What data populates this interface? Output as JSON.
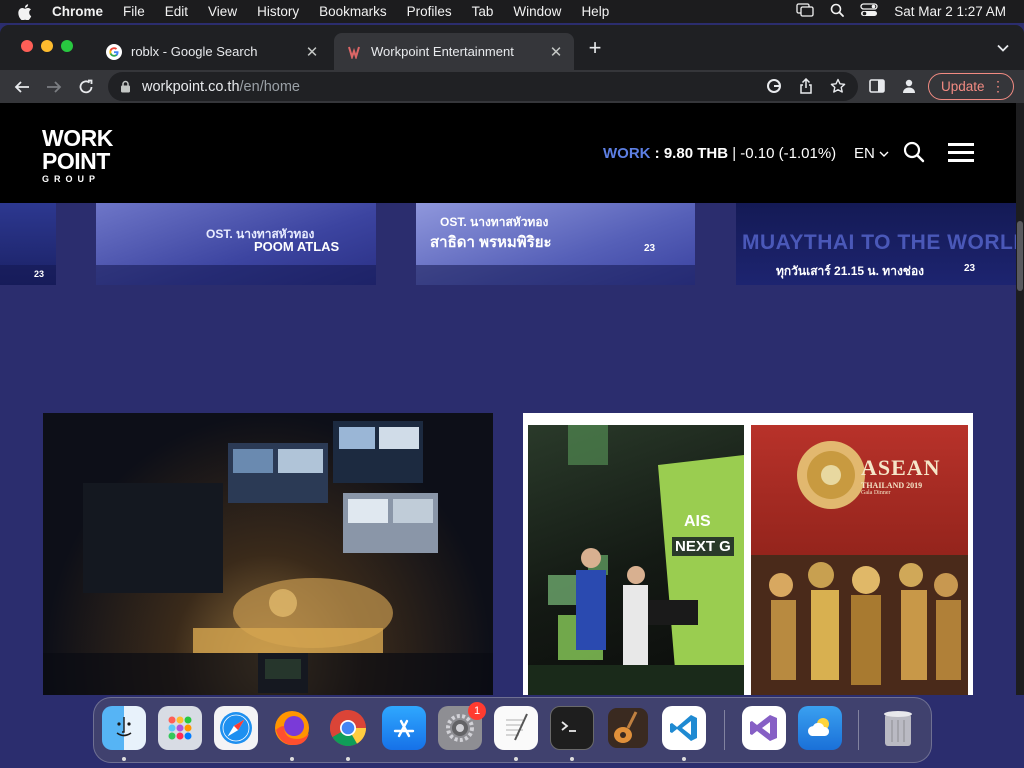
{
  "menubar": {
    "app": "Chrome",
    "items": [
      "File",
      "Edit",
      "View",
      "History",
      "Bookmarks",
      "Profiles",
      "Tab",
      "Window",
      "Help"
    ],
    "clock": "Sat Mar 2  1:27 AM"
  },
  "tabs": [
    {
      "title": "roblx - Google Search",
      "favicon": "google-g-icon"
    },
    {
      "title": "Workpoint Entertainment",
      "favicon": "workpoint-favicon-icon"
    }
  ],
  "toolbar": {
    "url_host": "workpoint.co.th",
    "url_path": "/en/home",
    "update_label": "Update"
  },
  "site": {
    "logo": {
      "line1": "WORK",
      "line2": "POINT",
      "line3": "GROUP"
    },
    "stock": {
      "symbol": "WORK",
      "colon": " : ",
      "price": "9.80 THB",
      "change": " | -0.10 (-1.01%)"
    },
    "language": "EN"
  },
  "banners": {
    "b2_title": "POOM ATLAS",
    "b2_sub": "OST. นางทาสหัวทอง",
    "b3_sub": "OST. นางทาสหัวทอง",
    "b3_title": "สาธิดา พรหมพิริยะ",
    "b4_title": "MUAYTHAI TO THE WORLD",
    "b4_sub": "ทุกวันเสาร์ 21.15 น. ทางช่อง",
    "channel": "23"
  },
  "photos": {
    "ais": "AIS",
    "nextg": "NEXT G",
    "asean_1": "ASEAN",
    "asean_2": "THAILAND 2019",
    "asean_3": "Gala Dinner"
  },
  "dock": {
    "apps": [
      "finder-icon",
      "launchpad-icon",
      "safari-icon",
      "firefox-icon",
      "chrome-icon",
      "app-store-icon",
      "system-preferences-icon",
      "textedit-icon",
      "terminal-icon",
      "garageband-icon",
      "vscode-icon",
      "visual-studio-icon",
      "weather-icon",
      "trash-icon"
    ],
    "settings_badge": "1"
  }
}
